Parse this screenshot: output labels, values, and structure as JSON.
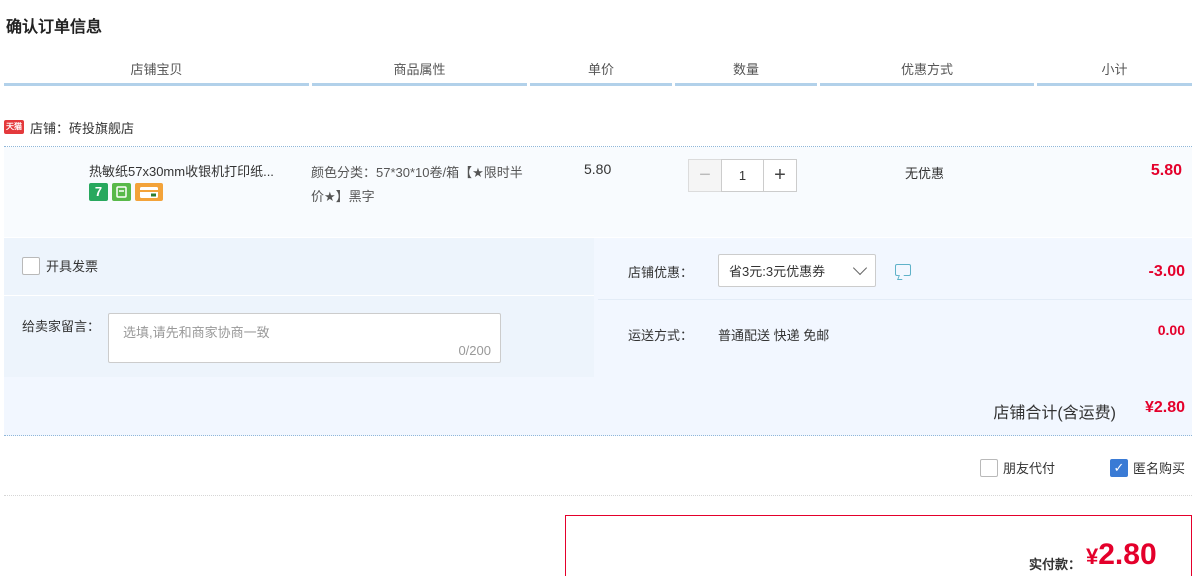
{
  "page": {
    "title": "确认订单信息"
  },
  "columns": [
    "店铺宝贝",
    "商品属性",
    "单价",
    "数量",
    "优惠方式",
    "小计"
  ],
  "shop": {
    "badge": "天猫",
    "label": "店铺：",
    "name": "砖投旗舰店"
  },
  "item": {
    "title": "热敏纸57x30mm收银机打印纸...",
    "badges": [
      "7",
      "",
      ""
    ],
    "attributes": "颜色分类：57*30*10卷/箱【★限时半价★】黑字",
    "price": "5.80",
    "quantity": "1",
    "promo": "无优惠",
    "subtotal": "5.80"
  },
  "options": {
    "invoice_label": "开具发票",
    "message_label": "给卖家留言：",
    "message_placeholder": "选填,请先和商家协商一致",
    "message_count": "0/200",
    "shop_discount_label": "店铺优惠：",
    "coupon_selected": "省3元:3元优惠券",
    "discount_value": "-3.00",
    "shipping_label": "运送方式：",
    "shipping_method": "普通配送 快递 免邮",
    "shipping_value": "0.00",
    "total_label": "店铺合计(含运费)",
    "total_value": "¥2.80"
  },
  "extras": {
    "friend_pay": "朋友代付",
    "anonymous": "匿名购买",
    "anonymous_checked": true
  },
  "payment": {
    "label": "实付款：",
    "currency": "¥",
    "amount": "2.80"
  },
  "colors": {
    "accent": "#e4002b",
    "header_line": "#b2d1ea",
    "panel": "#f2f7ff",
    "check": "#3a7bd5"
  }
}
